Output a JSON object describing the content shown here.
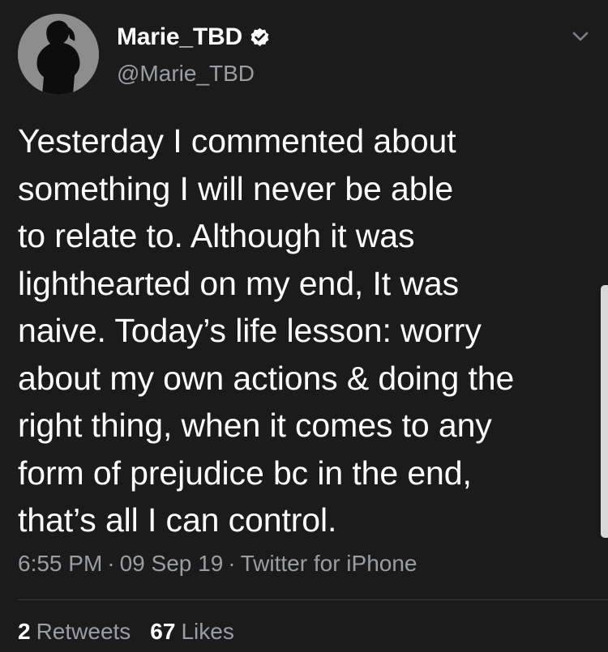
{
  "user": {
    "display_name": "Marie_TBD",
    "handle": "@Marie_TBD",
    "verified": true
  },
  "tweet": {
    "text": "Yesterday I commented about\nsomething I will never be able\nto relate to. Although it was\nlighthearted on my end, It was\nnaive. Today’s life lesson: worry\nabout my own actions & doing the\nright thing, when it comes to any\nform of prejudice bc in the end,\nthat’s all I can control."
  },
  "meta": {
    "time": "6:55 PM",
    "date": "09 Sep 19",
    "source": "Twitter for iPhone",
    "separator": "·"
  },
  "stats": {
    "retweets_count": "2",
    "retweets_label": "Retweets",
    "likes_count": "67",
    "likes_label": "Likes"
  },
  "icons": {
    "verified": "verified-badge-icon",
    "menu": "chevron-down-icon"
  },
  "colors": {
    "background": "#1b1b1c",
    "text": "#ffffff",
    "secondary_text": "#9a9ea3",
    "divider": "#3a3b3d"
  }
}
